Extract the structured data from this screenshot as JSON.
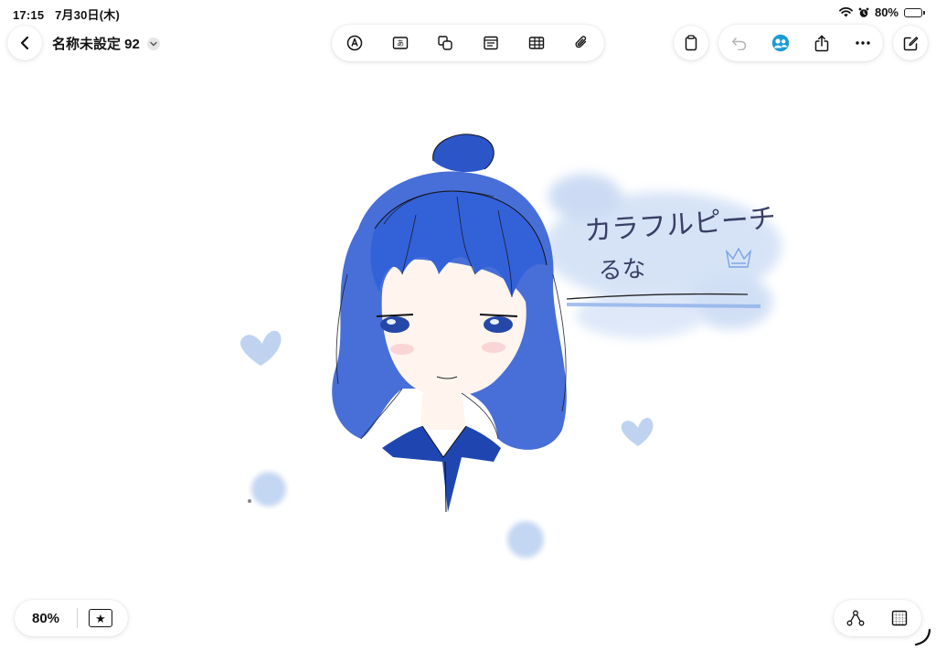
{
  "status_bar": {
    "time": "17:15",
    "date": "7月30日(木)",
    "battery": "80%"
  },
  "header": {
    "title": "名称未設定 92"
  },
  "drawing": {
    "text_line1": "カラフルピーチ",
    "text_line2": "るな",
    "accent_color": "#2f5bd3",
    "wash_color": "#b9cdf0"
  },
  "footer": {
    "zoom": "80%",
    "favorite_glyph": "★"
  },
  "icons": {
    "back": "chevron-left-icon",
    "title_menu": "chevron-down-icon",
    "pen": "markup-pen-icon",
    "text": "text-box-icon",
    "shapes": "shapes-icon",
    "note": "note-card-icon",
    "table": "table-icon",
    "attach": "paperclip-icon",
    "clipboard": "clipboard-icon",
    "undo": "undo-icon",
    "collab": "collaborate-icon",
    "share": "share-icon",
    "more": "ellipsis-icon",
    "compose": "compose-icon",
    "connect": "connector-icon",
    "grid": "grid-icon"
  }
}
